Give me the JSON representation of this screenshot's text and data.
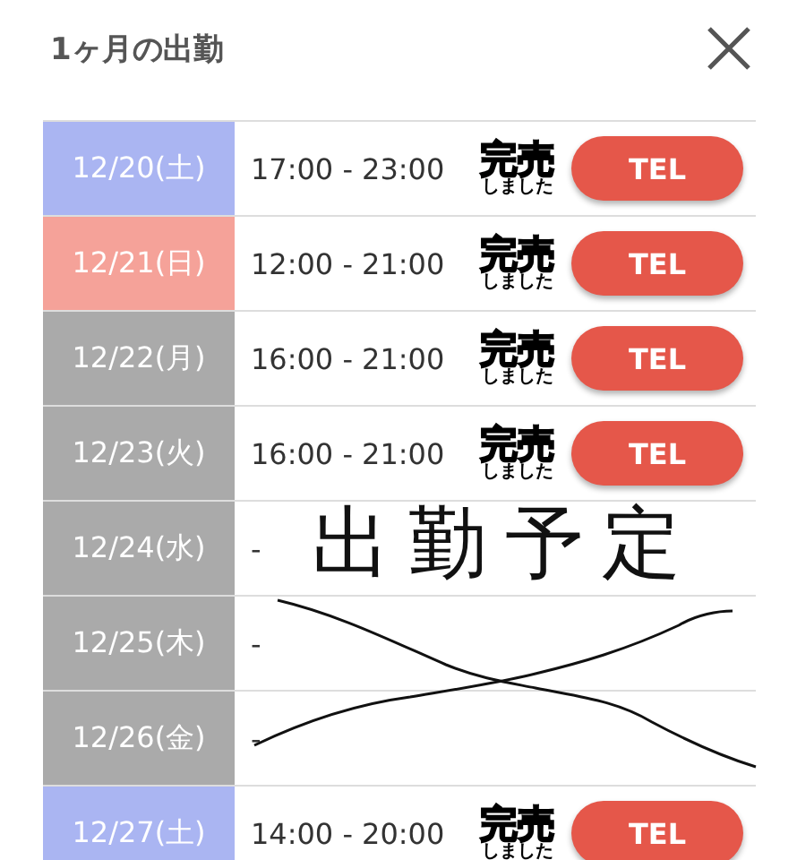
{
  "header": {
    "title": "1ヶ月の出勤"
  },
  "schedule": [
    {
      "date": "12/20(土)",
      "color": "#aab5f2",
      "time": "17:00 - 23:00",
      "badge": "完売",
      "badge_sub": "しました",
      "button": "TEL"
    },
    {
      "date": "12/21(日)",
      "color": "#f5a299",
      "time": "12:00 - 21:00",
      "badge": "完売",
      "badge_sub": "しました",
      "button": "TEL"
    },
    {
      "date": "12/22(月)",
      "color": "#aaaaaa",
      "time": "16:00 - 21:00",
      "badge": "完売",
      "badge_sub": "しました",
      "button": "TEL"
    },
    {
      "date": "12/23(火)",
      "color": "#aaaaaa",
      "time": "16:00 - 21:00",
      "badge": "完売",
      "badge_sub": "しました",
      "button": "TEL"
    },
    {
      "date": "12/24(水)",
      "color": "#aaaaaa",
      "time": "-"
    },
    {
      "date": "12/25(木)",
      "color": "#aaaaaa",
      "time": "-"
    },
    {
      "date": "12/26(金)",
      "color": "#aaaaaa",
      "time": "-"
    },
    {
      "date": "12/27(土)",
      "color": "#aab5f2",
      "time": "14:00 - 20:00",
      "badge": "完売",
      "badge_sub": "しました",
      "button": "TEL"
    }
  ],
  "annotation": {
    "text": "出勤予定",
    "cross_out": true
  }
}
